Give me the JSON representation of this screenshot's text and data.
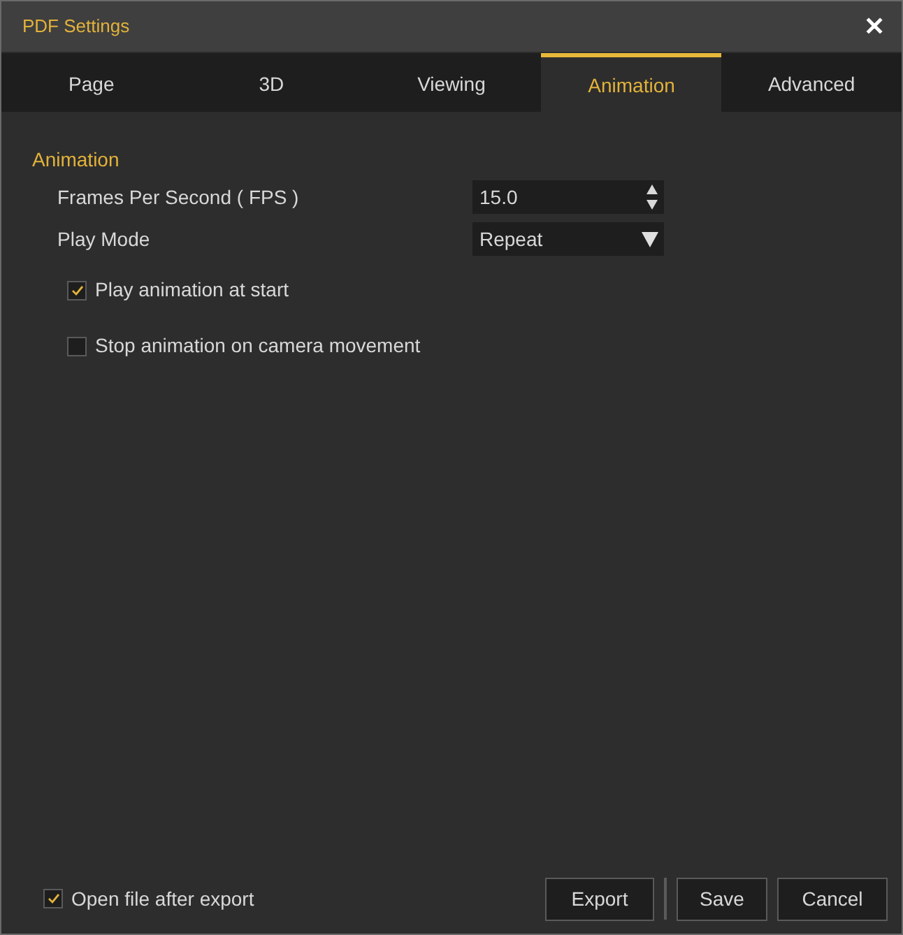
{
  "window": {
    "title": "PDF Settings",
    "close": "✕"
  },
  "tabs": [
    {
      "label": "Page",
      "selected": false
    },
    {
      "label": "3D",
      "selected": false
    },
    {
      "label": "Viewing",
      "selected": false
    },
    {
      "label": "Animation",
      "selected": true
    },
    {
      "label": "Advanced",
      "selected": false
    }
  ],
  "section": {
    "title": "Animation",
    "fields": [
      {
        "kind": "spinner",
        "label": "Frames Per Second ( FPS )",
        "value": "15.0"
      },
      {
        "kind": "dropdown",
        "label": "Play Mode",
        "value": "Repeat"
      }
    ],
    "checkboxes": [
      {
        "label": "Play animation at start",
        "checked": true
      },
      {
        "label": "Stop animation on camera movement",
        "checked": false
      }
    ]
  },
  "footer": {
    "checkbox": {
      "label": "Open file after export",
      "checked": true
    },
    "buttons": [
      "Export",
      "Save",
      "Cancel"
    ]
  }
}
